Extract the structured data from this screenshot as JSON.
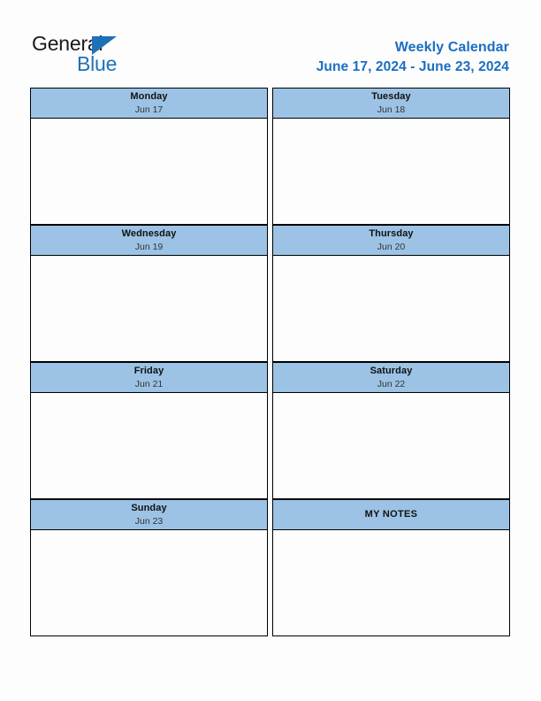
{
  "logo": {
    "word_one": "General",
    "word_two": "Blue",
    "triangle_color": "#1d71b8"
  },
  "header": {
    "title": "Weekly Calendar",
    "date_range": "June 17, 2024 - June 23, 2024",
    "accent_color": "#1b6ec2"
  },
  "theme": {
    "header_band_color": "#9cc3e5",
    "border_color": "#000000",
    "page_background": "#fdfdfd"
  },
  "calendar": {
    "rows": [
      {
        "left": {
          "day": "Monday",
          "date": "Jun 17",
          "content": ""
        },
        "right": {
          "day": "Tuesday",
          "date": "Jun 18",
          "content": ""
        }
      },
      {
        "left": {
          "day": "Wednesday",
          "date": "Jun 19",
          "content": ""
        },
        "right": {
          "day": "Thursday",
          "date": "Jun 20",
          "content": ""
        }
      },
      {
        "left": {
          "day": "Friday",
          "date": "Jun 21",
          "content": ""
        },
        "right": {
          "day": "Saturday",
          "date": "Jun 22",
          "content": ""
        }
      },
      {
        "left": {
          "day": "Sunday",
          "date": "Jun 23",
          "content": ""
        },
        "right": {
          "day": "MY NOTES",
          "date": "",
          "content": ""
        }
      }
    ]
  }
}
